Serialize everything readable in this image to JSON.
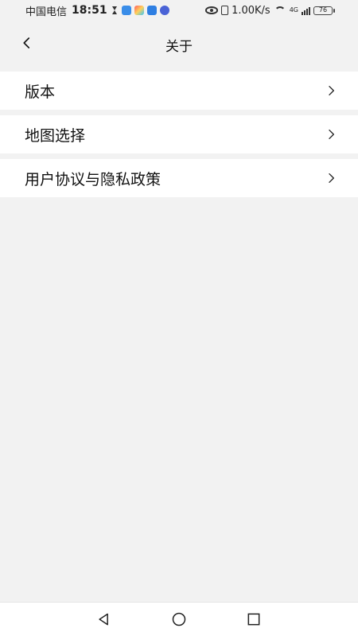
{
  "status_bar": {
    "carrier": "中国电信",
    "time": "18:51",
    "network_speed": "1.00K/s",
    "network_type": "4G",
    "battery": "76"
  },
  "header": {
    "title": "关于",
    "back_icon": "chevron-left-icon"
  },
  "menu": {
    "items": [
      {
        "label": "版本"
      },
      {
        "label": "地图选择"
      },
      {
        "label": "用户协议与隐私政策"
      }
    ]
  },
  "colors": {
    "page_background": "#f2f2f2",
    "item_background": "#ffffff",
    "text": "#111111"
  },
  "system_nav": {
    "back_icon": "triangle-back-icon",
    "home_icon": "circle-home-icon",
    "recent_icon": "square-recent-icon"
  }
}
